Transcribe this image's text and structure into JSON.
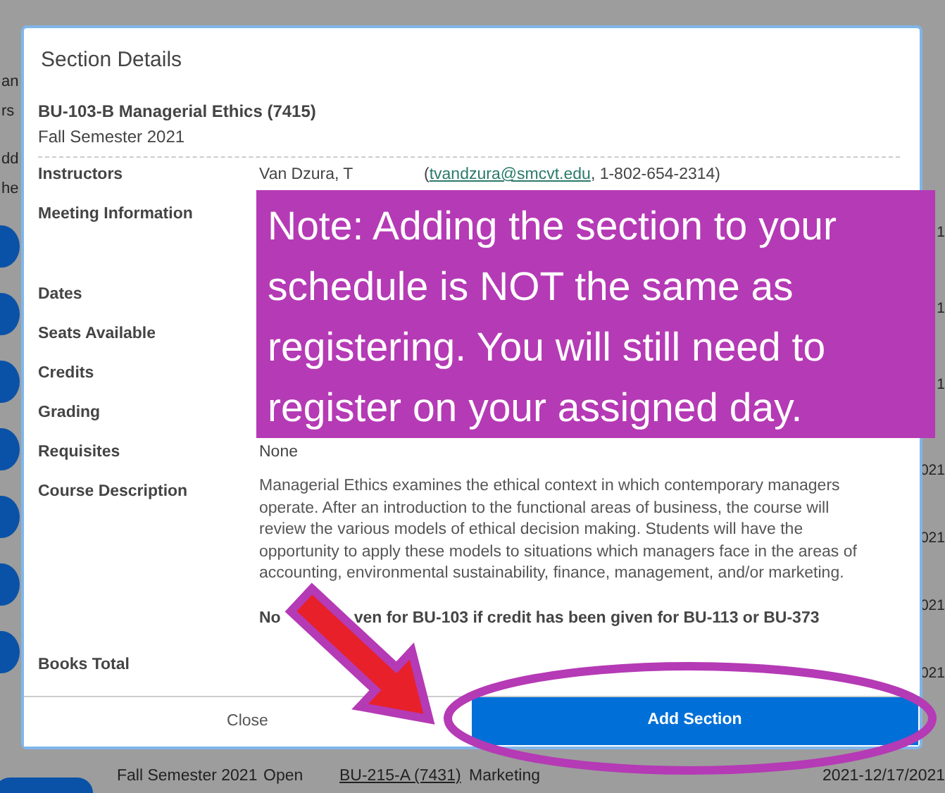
{
  "background": {
    "left_fragments": [
      "an",
      "rs",
      "dd",
      "he"
    ],
    "right_fragments": [
      "1",
      "1",
      "1",
      "021",
      "021",
      "021",
      "021"
    ],
    "row_cells": [
      "Fall Semester 2021",
      "Open",
      "BU-215-A (7431)",
      "Marketing",
      "2021-12/17/2021"
    ]
  },
  "modal": {
    "title": "Section Details",
    "course": "BU-103-B Managerial Ethics (7415)",
    "term": "Fall Semester 2021",
    "rows": [
      {
        "label": "Instructors",
        "value": "Van Dzura, T",
        "contact": {
          "before": "(",
          "email": "tvandzura@smcvt.edu",
          "after": ", 1-802-654-2314)"
        }
      },
      {
        "label": "Meeting Information"
      },
      {
        "label": "Dates"
      },
      {
        "label": "Seats Available"
      },
      {
        "label": "Credits"
      },
      {
        "label": "Grading"
      },
      {
        "label": "Requisites",
        "value": "None"
      },
      {
        "label": "Course Description",
        "value": "Managerial Ethics examines the ethical context in which contemporary managers operate. After an introduction to the functional areas of business, the course will review the various models of ethical decision making. Students will have the opportunity to apply these models to situations which managers face in the areas of accounting, environmental sustainability, finance, management, and/or marketing.",
        "note_parts": [
          "No",
          "ven for BU-103 if credit has been given for BU-113 or BU-373"
        ]
      },
      {
        "label": "Books Total"
      }
    ],
    "buttons": [
      {
        "label": "Close",
        "kind": "secondary"
      },
      {
        "label": "Add Section",
        "kind": "primary"
      }
    ]
  },
  "callout": {
    "text": "Note: Adding the section to your schedule is NOT the same as registering. You will still need to register on your assigned day."
  }
}
